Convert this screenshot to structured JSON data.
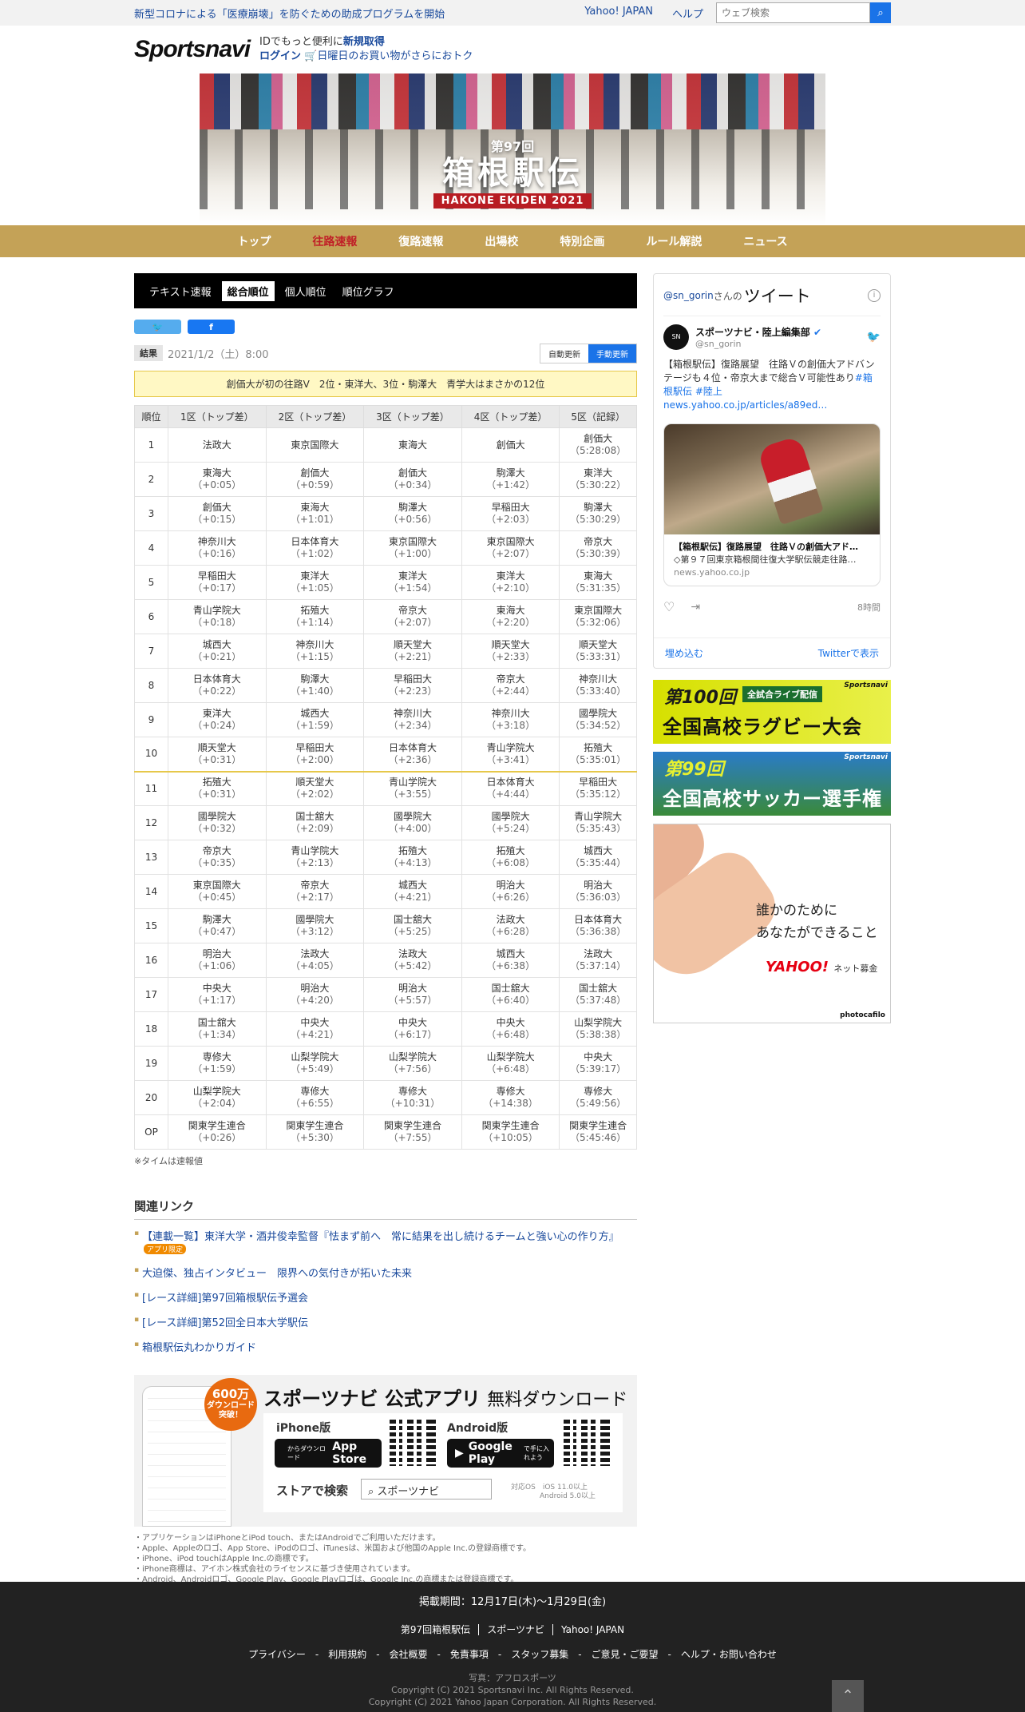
{
  "topbar": {
    "notice": "新型コロナによる「医療崩壊」を防ぐための助成プログラムを開始",
    "links": [
      "Yahoo! JAPAN",
      "ヘルプ"
    ],
    "search_placeholder": "ウェブ検索"
  },
  "header": {
    "logo": "Sportsnavi",
    "id_line1": "IDでもっと便利に",
    "id_signup": "新規取得",
    "id_login": "ログイン",
    "id_promo": "日曜日のお買い物がさらにおトク"
  },
  "hero": {
    "edition": "第97回",
    "title": "箱根駅伝",
    "subtitle": "HAKONE EKIDEN 2021"
  },
  "nav": [
    "トップ",
    "往路速報",
    "復路速報",
    "出場校",
    "特別企画",
    "ルール解説",
    "ニュース"
  ],
  "nav_active": 1,
  "tabs": [
    "テキスト速報",
    "総合順位",
    "個人順位",
    "順位グラフ"
  ],
  "tabs_active": 1,
  "meta": {
    "badge": "結果",
    "date": "2021/1/2（土）8:00",
    "auto": "自動更新",
    "manual": "手動更新"
  },
  "headline": "創価大が初の往路V　2位・東洋大、3位・駒澤大　青学大はまさかの12位",
  "table": {
    "headers": [
      "順位",
      "1区（トップ差）",
      "2区（トップ差）",
      "3区（トップ差）",
      "4区（トップ差）",
      "5区（記録）"
    ],
    "rows": [
      {
        "pos": "1",
        "cells": [
          [
            "法政大",
            ""
          ],
          [
            "東京国際大",
            ""
          ],
          [
            "東海大",
            ""
          ],
          [
            "創価大",
            ""
          ],
          [
            "創価大",
            "（5:28:08）"
          ]
        ]
      },
      {
        "pos": "2",
        "cells": [
          [
            "東海大",
            "（+0:05）"
          ],
          [
            "創価大",
            "（+0:59）"
          ],
          [
            "創価大",
            "（+0:34）"
          ],
          [
            "駒澤大",
            "（+1:42）"
          ],
          [
            "東洋大",
            "（5:30:22）"
          ]
        ]
      },
      {
        "pos": "3",
        "cells": [
          [
            "創価大",
            "（+0:15）"
          ],
          [
            "東海大",
            "（+1:01）"
          ],
          [
            "駒澤大",
            "（+0:56）"
          ],
          [
            "早稲田大",
            "（+2:03）"
          ],
          [
            "駒澤大",
            "（5:30:29）"
          ]
        ]
      },
      {
        "pos": "4",
        "cells": [
          [
            "神奈川大",
            "（+0:16）"
          ],
          [
            "日本体育大",
            "（+1:02）"
          ],
          [
            "東京国際大",
            "（+1:00）"
          ],
          [
            "東京国際大",
            "（+2:07）"
          ],
          [
            "帝京大",
            "（5:30:39）"
          ]
        ]
      },
      {
        "pos": "5",
        "cells": [
          [
            "早稲田大",
            "（+0:17）"
          ],
          [
            "東洋大",
            "（+1:05）"
          ],
          [
            "東洋大",
            "（+1:54）"
          ],
          [
            "東洋大",
            "（+2:10）"
          ],
          [
            "東海大",
            "（5:31:35）"
          ]
        ]
      },
      {
        "pos": "6",
        "cells": [
          [
            "青山学院大",
            "（+0:18）"
          ],
          [
            "拓殖大",
            "（+1:14）"
          ],
          [
            "帝京大",
            "（+2:07）"
          ],
          [
            "東海大",
            "（+2:20）"
          ],
          [
            "東京国際大",
            "（5:32:06）"
          ]
        ]
      },
      {
        "pos": "7",
        "cells": [
          [
            "城西大",
            "（+0:21）"
          ],
          [
            "神奈川大",
            "（+1:15）"
          ],
          [
            "順天堂大",
            "（+2:21）"
          ],
          [
            "順天堂大",
            "（+2:33）"
          ],
          [
            "順天堂大",
            "（5:33:31）"
          ]
        ]
      },
      {
        "pos": "8",
        "cells": [
          [
            "日本体育大",
            "（+0:22）"
          ],
          [
            "駒澤大",
            "（+1:40）"
          ],
          [
            "早稲田大",
            "（+2:23）"
          ],
          [
            "帝京大",
            "（+2:44）"
          ],
          [
            "神奈川大",
            "（5:33:40）"
          ]
        ]
      },
      {
        "pos": "9",
        "cells": [
          [
            "東洋大",
            "（+0:24）"
          ],
          [
            "城西大",
            "（+1:59）"
          ],
          [
            "神奈川大",
            "（+2:34）"
          ],
          [
            "神奈川大",
            "（+3:18）"
          ],
          [
            "國學院大",
            "（5:34:52）"
          ]
        ]
      },
      {
        "pos": "10",
        "cells": [
          [
            "順天堂大",
            "（+0:31）"
          ],
          [
            "早稲田大",
            "（+2:00）"
          ],
          [
            "日本体育大",
            "（+2:36）"
          ],
          [
            "青山学院大",
            "（+3:41）"
          ],
          [
            "拓殖大",
            "（5:35:01）"
          ]
        ]
      },
      {
        "pos": "11",
        "cells": [
          [
            "拓殖大",
            "（+0:31）"
          ],
          [
            "順天堂大",
            "（+2:02）"
          ],
          [
            "青山学院大",
            "（+3:55）"
          ],
          [
            "日本体育大",
            "（+4:44）"
          ],
          [
            "早稲田大",
            "（5:35:12）"
          ]
        ]
      },
      {
        "pos": "12",
        "cells": [
          [
            "國學院大",
            "（+0:32）"
          ],
          [
            "国士舘大",
            "（+2:09）"
          ],
          [
            "國學院大",
            "（+4:00）"
          ],
          [
            "國學院大",
            "（+5:24）"
          ],
          [
            "青山学院大",
            "（5:35:43）"
          ]
        ]
      },
      {
        "pos": "13",
        "cells": [
          [
            "帝京大",
            "（+0:35）"
          ],
          [
            "青山学院大",
            "（+2:13）"
          ],
          [
            "拓殖大",
            "（+4:13）"
          ],
          [
            "拓殖大",
            "（+6:08）"
          ],
          [
            "城西大",
            "（5:35:44）"
          ]
        ]
      },
      {
        "pos": "14",
        "cells": [
          [
            "東京国際大",
            "（+0:45）"
          ],
          [
            "帝京大",
            "（+2:17）"
          ],
          [
            "城西大",
            "（+4:21）"
          ],
          [
            "明治大",
            "（+6:26）"
          ],
          [
            "明治大",
            "（5:36:03）"
          ]
        ]
      },
      {
        "pos": "15",
        "cells": [
          [
            "駒澤大",
            "（+0:47）"
          ],
          [
            "國學院大",
            "（+3:12）"
          ],
          [
            "国士舘大",
            "（+5:25）"
          ],
          [
            "法政大",
            "（+6:28）"
          ],
          [
            "日本体育大",
            "（5:36:38）"
          ]
        ]
      },
      {
        "pos": "16",
        "cells": [
          [
            "明治大",
            "（+1:06）"
          ],
          [
            "法政大",
            "（+4:05）"
          ],
          [
            "法政大",
            "（+5:42）"
          ],
          [
            "城西大",
            "（+6:38）"
          ],
          [
            "法政大",
            "（5:37:14）"
          ]
        ]
      },
      {
        "pos": "17",
        "cells": [
          [
            "中央大",
            "（+1:17）"
          ],
          [
            "明治大",
            "（+4:20）"
          ],
          [
            "明治大",
            "（+5:57）"
          ],
          [
            "国士舘大",
            "（+6:40）"
          ],
          [
            "国士舘大",
            "（5:37:48）"
          ]
        ]
      },
      {
        "pos": "18",
        "cells": [
          [
            "国士舘大",
            "（+1:34）"
          ],
          [
            "中央大",
            "（+4:21）"
          ],
          [
            "中央大",
            "（+6:17）"
          ],
          [
            "中央大",
            "（+6:48）"
          ],
          [
            "山梨学院大",
            "（5:38:38）"
          ]
        ]
      },
      {
        "pos": "19",
        "cells": [
          [
            "専修大",
            "（+1:59）"
          ],
          [
            "山梨学院大",
            "（+5:49）"
          ],
          [
            "山梨学院大",
            "（+7:56）"
          ],
          [
            "山梨学院大",
            "（+6:48）"
          ],
          [
            "中央大",
            "（5:39:17）"
          ]
        ]
      },
      {
        "pos": "20",
        "cells": [
          [
            "山梨学院大",
            "（+2:04）"
          ],
          [
            "専修大",
            "（+6:55）"
          ],
          [
            "専修大",
            "（+10:31）"
          ],
          [
            "専修大",
            "（+14:38）"
          ],
          [
            "専修大",
            "（5:49:56）"
          ]
        ]
      },
      {
        "pos": "OP",
        "cells": [
          [
            "関東学生連合",
            "（+0:26）"
          ],
          [
            "関東学生連合",
            "（+5:30）"
          ],
          [
            "関東学生連合",
            "（+7:55）"
          ],
          [
            "関東学生連合",
            "（+10:05）"
          ],
          [
            "関東学生連合",
            "（5:45:46）"
          ]
        ]
      }
    ],
    "note": "※タイムは速報値"
  },
  "related": {
    "title": "関連リンク",
    "items": [
      "【連載一覧】東洋大学・酒井俊幸監督『怯まず前へ　常に結果を出し続けるチームと強い心の作り方』",
      "大迫傑、独占インタビュー　限界への気付きが拓いた未来",
      "[レース詳細]第97回箱根駅伝予選会",
      "[レース詳細]第52回全日本大学駅伝",
      "箱根駅伝丸わかりガイド"
    ],
    "app_badge": "アプリ限定"
  },
  "app": {
    "circle_num": "600万",
    "circle_text": "ダウンロード突破！",
    "title": "スポーツナビ 公式アプリ",
    "title_sub": "無料ダウンロード",
    "iphone": "iPhone版",
    "android": "Android版",
    "appstore": "App Store",
    "appstore_sub": "からダウンロード",
    "gplay": "Google Play",
    "gplay_sub": "で手に入れよう",
    "search_label": "ストアで検索",
    "search_value": "スポーツナビ",
    "os_label": "対応OS",
    "os1": "iOS 11.0以上",
    "os2": "Android 5.0以上",
    "disclaimers": [
      "・アプリケーションはiPhoneとiPod touch、またはAndroidでご利用いただけます。",
      "・Apple、Appleのロゴ、App Store、iPodのロゴ、iTunesは、米国および他国のApple Inc.の登録商標です。",
      "・iPhone、iPod touchはApple Inc.の商標です。",
      "・iPhone商標は、アイホン株式会社のライセンスに基づき使用されています。",
      "・Android、Androidロゴ、Google Play、Google Playロゴは、Google Inc.の商標または登録商標です。"
    ]
  },
  "tweet": {
    "handle": "@sn_gorin",
    "san": "さんの",
    "label": "ツイート",
    "user": "スポーツナビ・陸上編集部",
    "user_handle": "@sn_gorin",
    "text": "【箱根駅伝】復路展望　往路Ｖの創価大アドバンテージも４位・帝京大まで総合Ｖ可能性あり",
    "tags": "#箱根駅伝 #陸上 news.yahoo.co.jp/articles/a89ed…",
    "card_title": "【箱根駅伝】復路展望　往路Ｖの創価大アド…",
    "card_desc": "◇第９７回東京箱根間往復大学駅伝競走往路…",
    "card_url": "news.yahoo.co.jp",
    "time": "8時間",
    "embed": "埋め込む",
    "view": "Twitterで表示"
  },
  "banners": {
    "rugby_num": "第100回",
    "rugby_tag": "全試合ライブ配信",
    "rugby_title": "全国高校ラグビー大会",
    "soccer_num": "第99回",
    "soccer_title": "全国高校サッカー選手権",
    "sn_logo": "Sportsnavi",
    "donate_l1": "誰かのために",
    "donate_l2": "あなたができること",
    "donate_brand": "YAHOO!",
    "donate_sub": "ネット募金",
    "photo": "photocafilo"
  },
  "footer": {
    "period": "掲載期間：12月17日(木)〜1月29日(金)",
    "links1": [
      "第97回箱根駅伝",
      "スポーツナビ",
      "Yahoo! JAPAN"
    ],
    "links2": "プライバシー　-　利用規約　-　会社概要　-　免責事項　-　スタッフ募集　-　ご意見・ご要望　-　ヘルプ・お問い合わせ",
    "photo": "写真：アフロスポーツ",
    "copy1": "Copyright (C) 2021 Sportsnavi Inc. All Rights Reserved.",
    "copy2": "Copyright (C) 2021 Yahoo Japan Corporation. All Rights Reserved."
  }
}
